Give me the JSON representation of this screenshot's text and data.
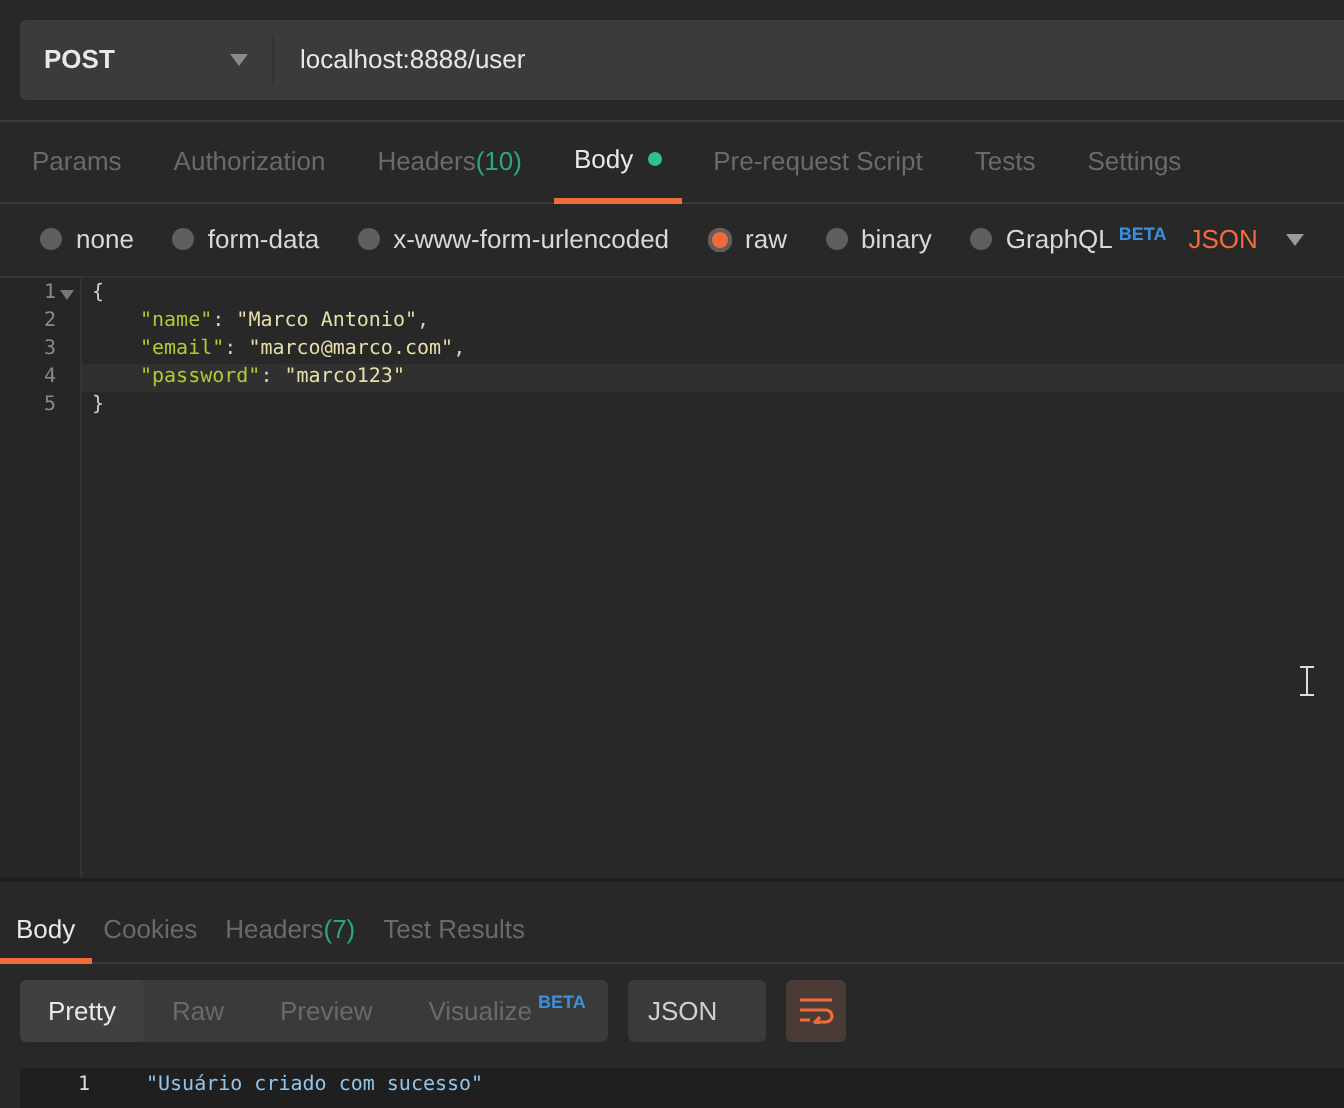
{
  "request": {
    "method": "POST",
    "url": "localhost:8888/user"
  },
  "tabs": [
    {
      "label": "Params",
      "selected": false
    },
    {
      "label": "Authorization",
      "selected": false
    },
    {
      "label": "Headers",
      "count": "(10)",
      "selected": false
    },
    {
      "label": "Body",
      "dot": true,
      "selected": true
    },
    {
      "label": "Pre-request Script",
      "selected": false
    },
    {
      "label": "Tests",
      "selected": false
    },
    {
      "label": "Settings",
      "selected": false
    }
  ],
  "body_types": [
    {
      "label": "none",
      "selected": false
    },
    {
      "label": "form-data",
      "selected": false
    },
    {
      "label": "x-www-form-urlencoded",
      "selected": false
    },
    {
      "label": "raw",
      "selected": true
    },
    {
      "label": "binary",
      "selected": false
    },
    {
      "label": "GraphQL",
      "badge": "BETA",
      "selected": false
    }
  ],
  "body_format": "JSON",
  "editor": {
    "lines": [
      {
        "number": "1",
        "active": false,
        "tokens": [
          {
            "kind": "punct",
            "text": "{"
          }
        ],
        "children": [
          {
            "number": "2",
            "active": false,
            "tokens": [
              {
                "kind": "key",
                "text": "\"name\""
              },
              {
                "kind": "punct",
                "text": ": "
              },
              {
                "kind": "string",
                "text": "\"Marco Antonio\""
              },
              {
                "kind": "punct",
                "text": ","
              }
            ]
          },
          {
            "number": "3",
            "active": false,
            "tokens": [
              {
                "kind": "key",
                "text": "\"email\""
              },
              {
                "kind": "punct",
                "text": ": "
              },
              {
                "kind": "string",
                "text": "\"marco@marco.com\""
              },
              {
                "kind": "punct",
                "text": ","
              }
            ]
          },
          {
            "number": "4",
            "active": true,
            "tokens": [
              {
                "kind": "key",
                "text": "\"password\""
              },
              {
                "kind": "punct",
                "text": ": "
              },
              {
                "kind": "string",
                "text": "\"marco123\""
              }
            ]
          }
        ]
      },
      {
        "number": "5",
        "active": false,
        "tokens": [
          {
            "kind": "punct",
            "text": "}"
          }
        ]
      }
    ]
  },
  "response": {
    "tabs": [
      {
        "label": "Body",
        "selected": true
      },
      {
        "label": "Cookies",
        "selected": false
      },
      {
        "label": "Headers",
        "count": "(7)",
        "selected": false
      },
      {
        "label": "Test Results",
        "selected": false
      }
    ],
    "views": [
      {
        "label": "Pretty",
        "selected": true
      },
      {
        "label": "Raw",
        "selected": false
      },
      {
        "label": "Preview",
        "selected": false
      },
      {
        "label": "Visualize",
        "badge": "BETA",
        "selected": false
      }
    ],
    "format": "JSON",
    "lines": [
      {
        "number": "1",
        "text": "\"Usuário criado com sucesso\""
      }
    ]
  }
}
